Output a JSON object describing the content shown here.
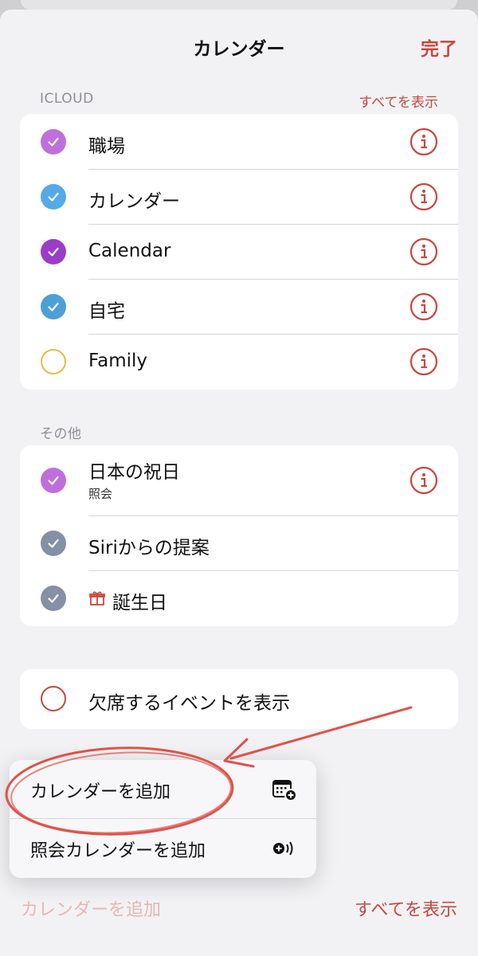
{
  "header": {
    "title": "カレンダー",
    "done_label": "完了"
  },
  "icloud": {
    "header": "ICLOUD",
    "show_all": "すべてを表示",
    "items": [
      {
        "label": "職場",
        "color": "#bf6fdc",
        "checked": true
      },
      {
        "label": "カレンダー",
        "color": "#55a9e8",
        "checked": true
      },
      {
        "label": "Calendar",
        "color": "#9a3dc8",
        "checked": true
      },
      {
        "label": "自宅",
        "color": "#4d9fd6",
        "checked": true
      },
      {
        "label": "Family",
        "color": "#e3bf3f",
        "checked": false
      }
    ]
  },
  "other": {
    "header": "その他",
    "items": [
      {
        "label": "日本の祝日",
        "sublabel": "照会",
        "color": "#bf6fdc",
        "checked": true,
        "info": true
      },
      {
        "label": "Siriからの提案",
        "color": "#8490a5",
        "checked": true,
        "info": false
      },
      {
        "label": "誕生日",
        "color": "#8490a5",
        "checked": true,
        "info": false,
        "icon": "gift-icon"
      }
    ]
  },
  "declined": {
    "label": "欠席するイベントを表示",
    "checked": false
  },
  "menu": {
    "items": [
      {
        "label": "カレンダーを追加",
        "icon": "calendar-add-icon"
      },
      {
        "label": "照会カレンダーを追加",
        "icon": "subscribe-icon"
      }
    ]
  },
  "footer": {
    "add_calendar": "カレンダーを追加",
    "show_all": "すべてを表示"
  },
  "colors": {
    "accent": "#c8473e",
    "annotation": "#e0524a"
  }
}
